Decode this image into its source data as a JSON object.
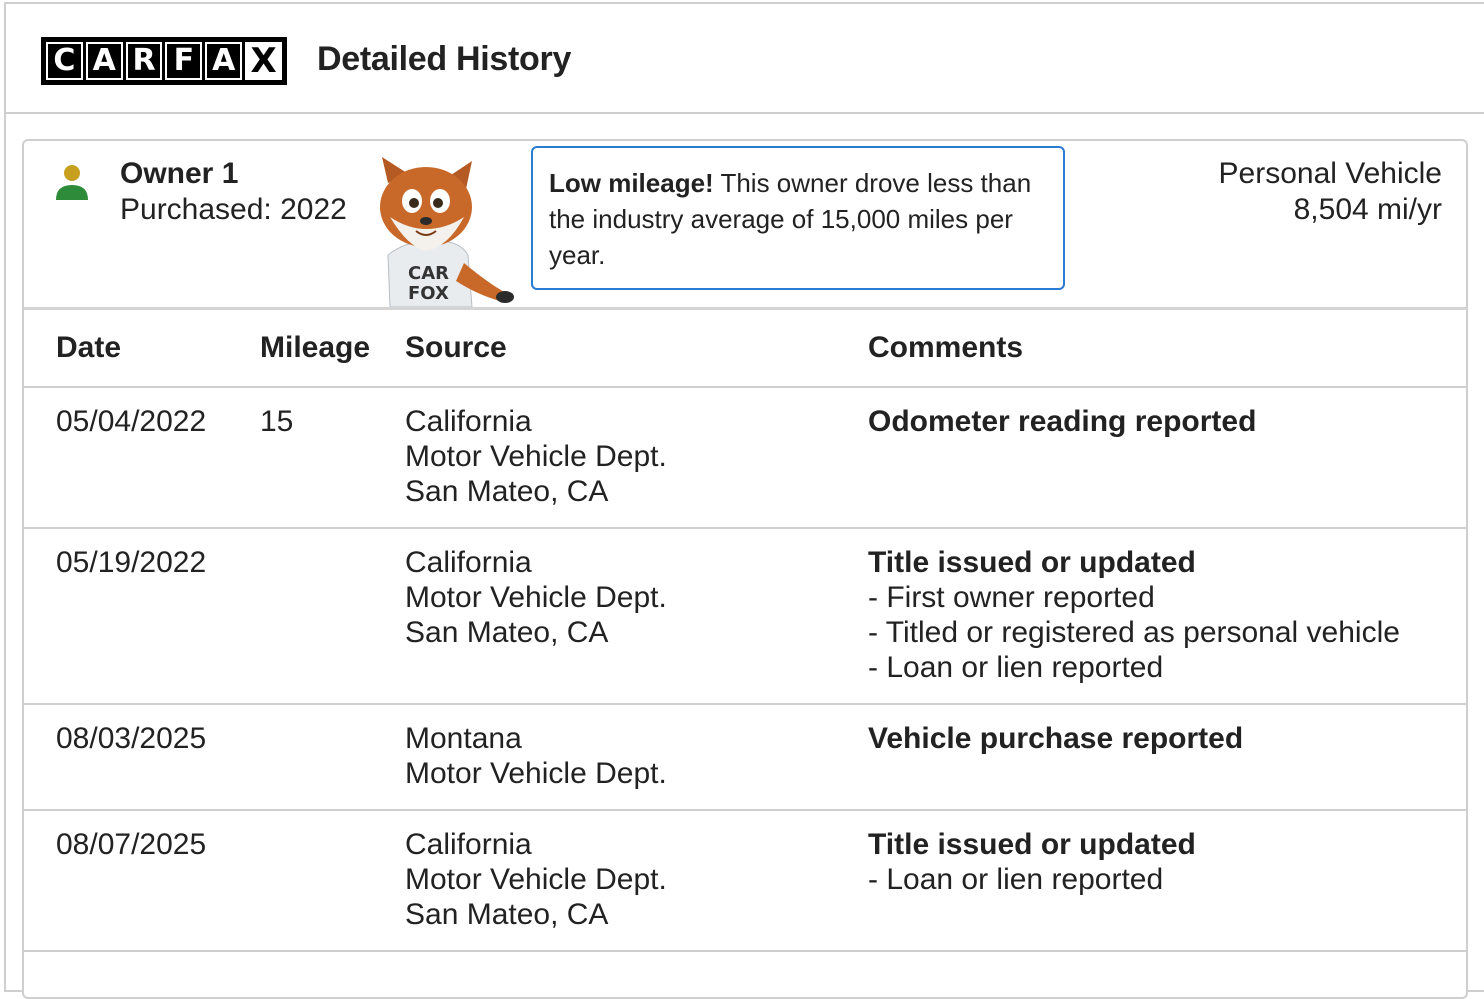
{
  "header": {
    "logo_letters": [
      "C",
      "A",
      "R",
      "F",
      "A",
      "X"
    ],
    "title": "Detailed History"
  },
  "owner": {
    "name": "Owner 1",
    "purchased": "Purchased: 2022",
    "mascot_text": "CAR FOX",
    "callout_bold": "Low mileage!",
    "callout_text": " This owner drove less than the industry average of 15,000 miles per year.",
    "vehicle_type": "Personal Vehicle",
    "miles_per_year": "8,504 mi/yr",
    "icon_colors": {
      "head": "#c8a020",
      "body": "#2e8b3a"
    }
  },
  "table": {
    "headers": [
      "Date",
      "Mileage",
      "Source",
      "Comments"
    ],
    "rows": [
      {
        "date": "05/04/2022",
        "mileage": "15",
        "source": [
          "California",
          "Motor Vehicle Dept.",
          "San Mateo, CA"
        ],
        "comment_title": "Odometer reading reported",
        "comment_items": []
      },
      {
        "date": "05/19/2022",
        "mileage": "",
        "source": [
          "California",
          "Motor Vehicle Dept.",
          "San Mateo, CA"
        ],
        "comment_title": "Title issued or updated",
        "comment_items": [
          "- First owner reported",
          "- Titled or registered as personal vehicle",
          "- Loan or lien reported"
        ]
      },
      {
        "date": "08/03/2025",
        "mileage": "",
        "source": [
          "Montana",
          "Motor Vehicle Dept."
        ],
        "comment_title": "Vehicle purchase reported",
        "comment_items": []
      },
      {
        "date": "08/07/2025",
        "mileage": "",
        "source": [
          "California",
          "Motor Vehicle Dept.",
          "San Mateo, CA"
        ],
        "comment_title": "Title issued or updated",
        "comment_items": [
          "- Loan or lien reported"
        ]
      }
    ]
  }
}
